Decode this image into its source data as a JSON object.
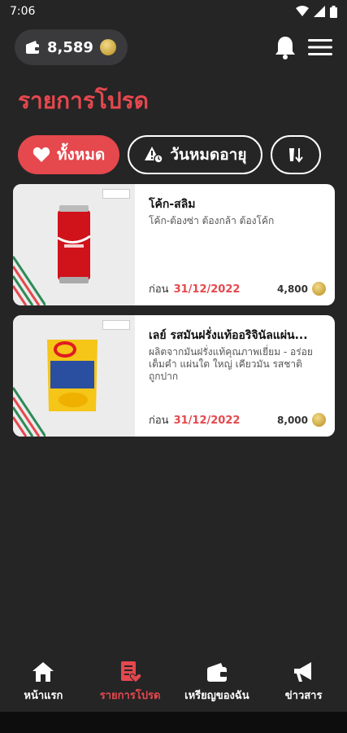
{
  "status_bar": {
    "time": "7:06"
  },
  "header": {
    "balance": "8,589"
  },
  "title": "รายการโปรด",
  "filters": [
    {
      "label": "ทั้งหมด",
      "icon": "heart-icon",
      "active": true
    },
    {
      "label": "วันหมดอายุ",
      "icon": "warning-clock-icon",
      "active": false
    },
    {
      "label": "",
      "icon": "sort-icon",
      "active": false
    }
  ],
  "items": [
    {
      "name": "โค้ก-สลิม",
      "desc": "โค้ก-ต้องซ่า ต้องกล้า ต้องโค้ก",
      "before_label": "ก่อน",
      "date": "31/12/2022",
      "price": "4,800"
    },
    {
      "name": "เลย์ รสมันฝรั่งแท้ออริจินัลแผ่น...",
      "desc": "ผลิตจากมันฝรั่งแท้คุณภาพเยี่ยม - อร่อยเต็มคำ แผ่นใต ใหญ่ เคียวมัน รสชาติถูกปาก",
      "before_label": "ก่อน",
      "date": "31/12/2022",
      "price": "8,000"
    }
  ],
  "nav": [
    {
      "label": "หน้าแรก",
      "icon": "home-icon"
    },
    {
      "label": "รายการโปรด",
      "icon": "favorites-list-icon"
    },
    {
      "label": "เหรียญของฉัน",
      "icon": "wallet-icon"
    },
    {
      "label": "ข่าวสาร",
      "icon": "megaphone-icon"
    }
  ],
  "colors": {
    "accent": "#e5484d",
    "background": "#252526",
    "card": "#ffffff"
  }
}
